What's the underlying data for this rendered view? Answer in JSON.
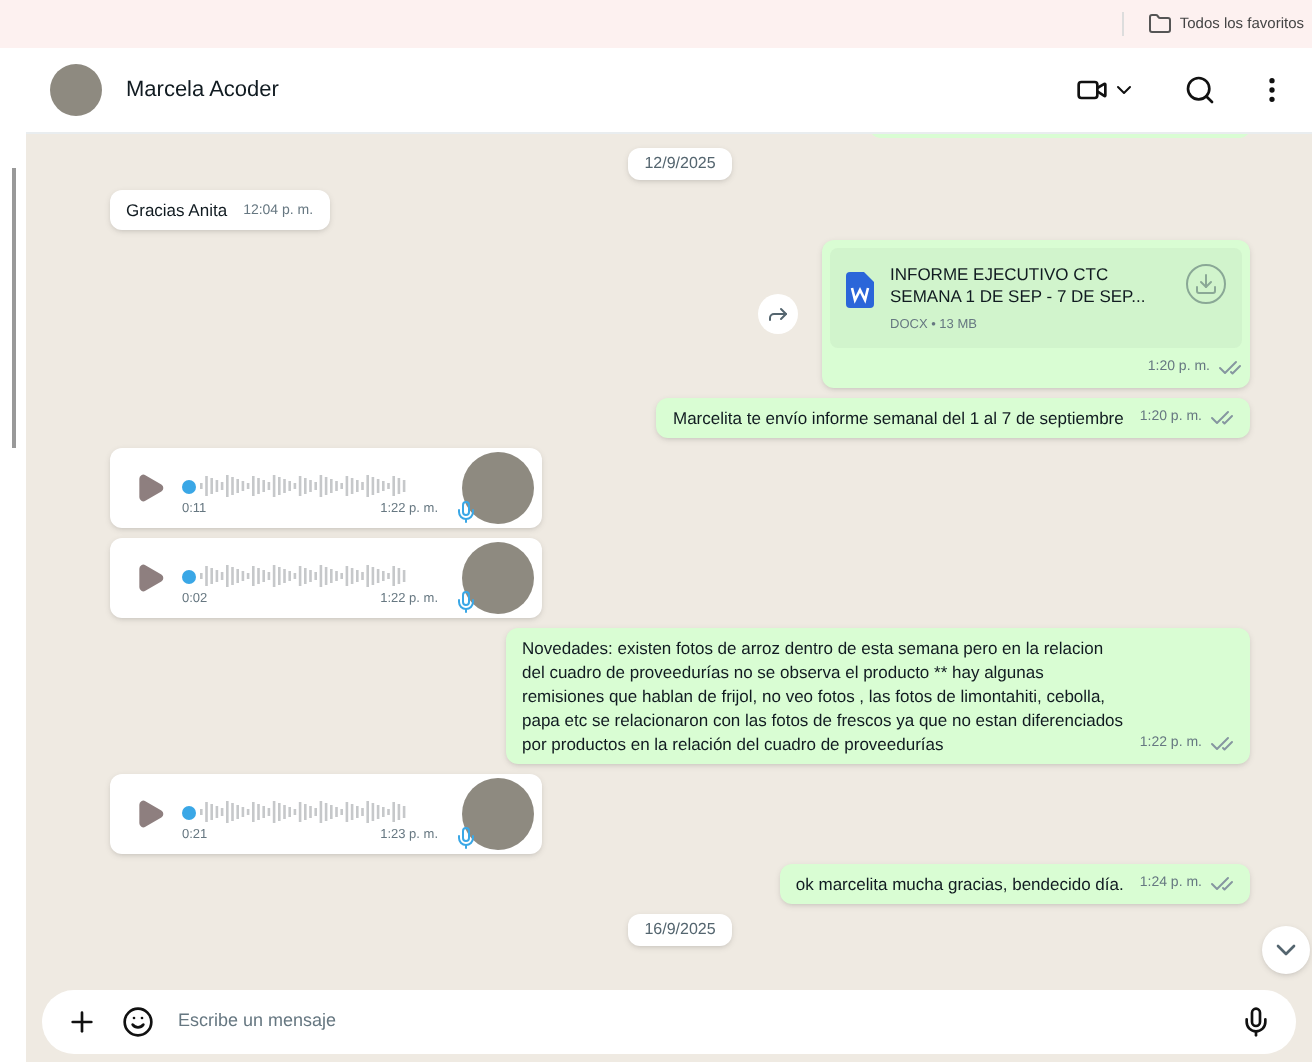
{
  "bookmarks_bar": {
    "label": "Todos los favoritos"
  },
  "header": {
    "name": "Marcela Acoder"
  },
  "messages": [
    {
      "kind": "partial",
      "outgoing": true
    },
    {
      "kind": "date",
      "text": "12/9/2025"
    },
    {
      "kind": "text",
      "outgoing": false,
      "text": "Gracias Anita",
      "time": "12:04 p. m."
    },
    {
      "kind": "document",
      "outgoing": true,
      "title": "INFORME EJECUTIVO CTC SEMANA 1 DE SEP - 7 DE SEP...",
      "meta": "DOCX • 13 MB",
      "time": "1:20 p. m."
    },
    {
      "kind": "text",
      "outgoing": true,
      "text": "Marcelita te envío informe semanal del 1 al 7 de septiembre",
      "time": "1:20 p. m."
    },
    {
      "kind": "audio",
      "outgoing": false,
      "duration": "0:11",
      "time": "1:22 p. m."
    },
    {
      "kind": "audio",
      "outgoing": false,
      "duration": "0:02",
      "time": "1:22 p. m."
    },
    {
      "kind": "text",
      "outgoing": true,
      "text": "Novedades: existen fotos de arroz dentro de esta semana pero en la relacion del cuadro de proveedurías no se observa el producto ** hay algunas remisiones que hablan de frijol, no veo fotos , las fotos de limontahiti, cebolla, papa etc se relacionaron con las fotos de frescos ya que no estan diferenciados por productos en la relación del cuadro de proveedurías",
      "time": "1:22 p. m."
    },
    {
      "kind": "audio",
      "outgoing": false,
      "duration": "0:21",
      "time": "1:23 p. m."
    },
    {
      "kind": "text",
      "outgoing": true,
      "text": "ok marcelita mucha gracias, bendecido día.",
      "time": "1:24 p. m."
    },
    {
      "kind": "date",
      "text": "16/9/2025"
    }
  ],
  "composer": {
    "placeholder": "Escribe un mensaje"
  }
}
